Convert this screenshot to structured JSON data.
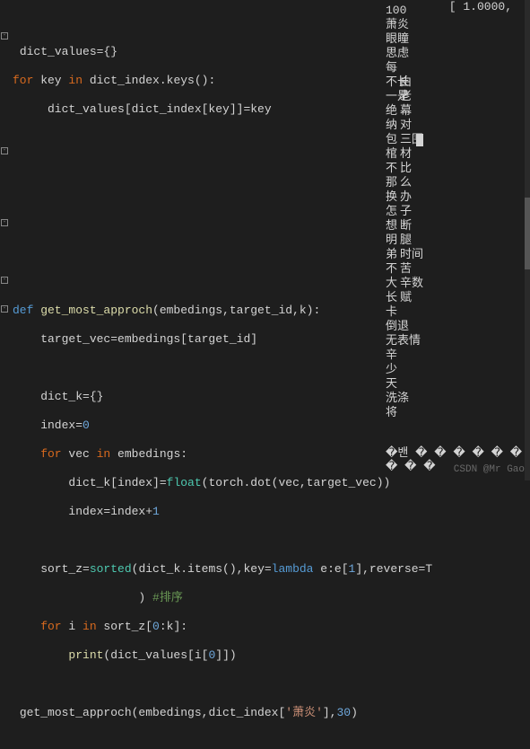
{
  "editor": {
    "code": {
      "l0": "",
      "l1": "dict_values={}",
      "l2_for": "for",
      "l2_var": " key ",
      "l2_in": "in",
      "l2_rest": " dict_index.keys():",
      "l3": "     dict_values[dict_index[key]]=key",
      "l4": "",
      "l5": "",
      "l6": "",
      "l7_def": "def",
      "l7_name": " get_most_approch",
      "l7_params": "(embedings,target_id,k):",
      "l8": "    target_vec=embedings[target_id]",
      "l9": "",
      "l10": "    dict_k={}",
      "l11_a": "    index=",
      "l11_num": "0",
      "l12_for": "    for",
      "l12_var": " vec ",
      "l12_in": "in",
      "l12_rest": " embedings:",
      "l13_a": "        dict_k[index]=",
      "l13_float": "float",
      "l13_b": "(torch.dot(vec,target_vec))",
      "l14_a": "        index=index+",
      "l14_num": "1",
      "l15": "",
      "l16_a": "    sort_z=",
      "l16_sorted": "sorted",
      "l16_b": "(dict_k.items(),key=",
      "l16_lambda": "lambda",
      "l16_c": " e:e[",
      "l16_one": "1",
      "l16_d": "],reverse=T",
      "l17_a": "                  ) ",
      "l17_comment": "#排序",
      "l18_for": "    for",
      "l18_var": " i ",
      "l18_in": "in",
      "l18_a": " sort_z[",
      "l18_zero": "0",
      "l18_b": ":k]:",
      "l19_print": "        print",
      "l19_a": "(dict_values[i[",
      "l19_zero": "0",
      "l19_b": "]])",
      "l20": "",
      "l21_a": "get_most_approch(embedings,dict_index[",
      "l21_str": "'萧炎'",
      "l21_b": "],",
      "l21_num": "30",
      "l21_c": ")"
    },
    "fold_marks": [
      "-",
      "-",
      "-",
      "-",
      "-"
    ]
  },
  "output": {
    "top_right": "[ 1.0000,",
    "header": "100",
    "col1": [
      "萧炎",
      "眼瞳",
      "思虑",
      "每",
      "不长",
      "一是",
      "绝",
      "纳",
      "包",
      "棺",
      "不",
      "那",
      "换",
      "怎",
      "想",
      "明",
      "弟",
      "不",
      "大",
      "长",
      "卡",
      "倒退",
      "无表情",
      "辛",
      "少",
      "天",
      "洗涤",
      "将"
    ],
    "col2": [
      "由",
      "老",
      "幕",
      "对",
      "三围",
      "材",
      "比",
      "",
      "",
      "么",
      "办",
      "",
      "子",
      "断",
      "腿",
      "时间",
      "",
      "",
      "",
      "苦",
      "辛数",
      "赋"
    ],
    "done": "�밴 � � � � � � � � �"
  },
  "misc": {
    "watermark": "CSDN @Mr Gao"
  }
}
